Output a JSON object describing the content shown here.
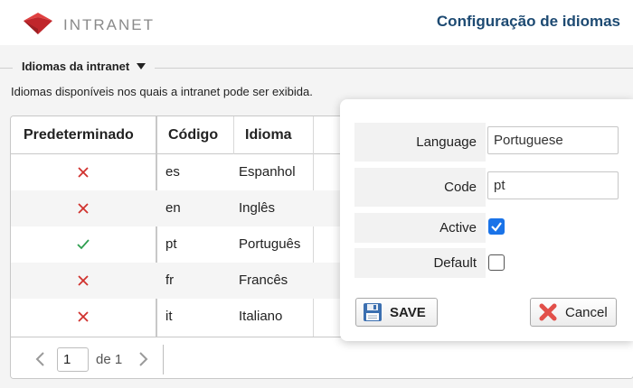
{
  "header": {
    "logo_text": "INTRANET",
    "page_title": "Configuração de idiomas"
  },
  "section": {
    "legend": "Idiomas da intranet",
    "description": "Idiomas disponíveis nos quais a intranet pode ser exibida."
  },
  "table": {
    "columns": [
      "Predeterminado",
      "Código",
      "Idioma"
    ],
    "rows": [
      {
        "default": false,
        "code": "es",
        "language": "Espanhol"
      },
      {
        "default": false,
        "code": "en",
        "language": "Inglês"
      },
      {
        "default": true,
        "code": "pt",
        "language": "Português"
      },
      {
        "default": false,
        "code": "fr",
        "language": "Francês"
      },
      {
        "default": false,
        "code": "it",
        "language": "Italiano"
      }
    ],
    "mark_colors": {
      "false": "#d0312d",
      "true": "#2e9e4f"
    }
  },
  "pager": {
    "page": "1",
    "of_label": "de",
    "total": "1"
  },
  "form": {
    "language_label": "Language",
    "language_value": "Portuguese",
    "code_label": "Code",
    "code_value": "pt",
    "active_label": "Active",
    "active": true,
    "default_label": "Default",
    "default": false,
    "save_label": "SAVE",
    "cancel_label": "Cancel"
  },
  "colors": {
    "brand_red": "#d0312d",
    "title_blue": "#1d4a72",
    "check_blue": "#1a73e8"
  }
}
